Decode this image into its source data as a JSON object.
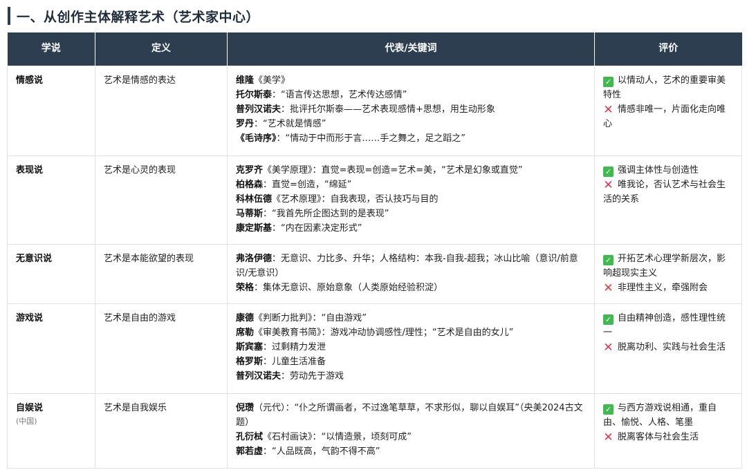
{
  "title": "一、从创作主体解释艺术（艺术家中心）",
  "columns": [
    "学说",
    "定义",
    "代表/关键词",
    "评价"
  ],
  "icons": {
    "positive": "check-icon",
    "negative": "cross-icon"
  },
  "colors": {
    "header_bg": "#2c3e50",
    "check": "#3fb950",
    "cross": "#e0344d"
  },
  "rows": [
    {
      "name": "情感说",
      "sub": "",
      "definition": "艺术是情感的表达",
      "reps": [
        {
          "who": "维隆",
          "text": "《美学》"
        },
        {
          "who": "托尔斯泰",
          "text": "：“语言传达思想，艺术传达感情”"
        },
        {
          "who": "普列汉诺夫",
          "text": "：批评托尔斯泰——艺术表现感情+思想，用生动形象"
        },
        {
          "who": "罗丹",
          "text": "：“艺术就是情感”"
        },
        {
          "who": "《毛诗序》",
          "text": "：“情动于中而形于言……手之舞之，足之蹈之”"
        }
      ],
      "pros": "以情动人，艺术的重要审美特性",
      "cons": "情感非唯一，片面化走向唯心"
    },
    {
      "name": "表现说",
      "sub": "",
      "definition": "艺术是心灵的表现",
      "reps": [
        {
          "who": "克罗齐",
          "text": "《美学原理》：直觉=表现=创造=艺术=美，“艺术是幻象或直觉”"
        },
        {
          "who": "柏格森",
          "text": "：直觉=创造，“绵延”"
        },
        {
          "who": "科林伍德",
          "text": "《艺术原理》：自我表现，否认技巧与目的"
        },
        {
          "who": "马蒂斯",
          "text": "：“我首先所企图达到的是表现”"
        },
        {
          "who": "康定斯基",
          "text": "：“内在因素决定形式”"
        }
      ],
      "pros": "强调主体性与创造性",
      "cons": "唯我论，否认艺术与社会生活的关系"
    },
    {
      "name": "无意识说",
      "sub": "",
      "definition": "艺术是本能欲望的表现",
      "reps": [
        {
          "who": "弗洛伊德",
          "text": "：无意识、力比多、升华；人格结构：本我-自我-超我；冰山比喻（意识/前意识/无意识）"
        },
        {
          "who": "荣格",
          "text": "：集体无意识、原始意象（人类原始经验积淀）"
        }
      ],
      "pros": "开拓艺术心理学新层次，影响超现实主义",
      "cons": "非理性主义，牵强附会"
    },
    {
      "name": "游戏说",
      "sub": "",
      "definition": "艺术是自由的游戏",
      "reps": [
        {
          "who": "康德",
          "text": "《判断力批判》：“自由游戏”"
        },
        {
          "who": "席勒",
          "text": "《审美教育书简》：游戏冲动协调感性/理性；“艺术是自由的女儿”"
        },
        {
          "who": "斯宾塞",
          "text": "：过剩精力发泄"
        },
        {
          "who": "格罗斯",
          "text": "：儿童生活准备"
        },
        {
          "who": "普列汉诺夫",
          "text": "：劳动先于游戏"
        }
      ],
      "pros": "自由精神创造，感性理性统一",
      "cons": "脱离功利、实践与社会生活"
    },
    {
      "name": "自娱说",
      "sub": "(中国)",
      "definition": "艺术是自我娱乐",
      "reps": [
        {
          "who": "倪瓒",
          "text": "（元代）：“仆之所谓画者，不过逸笔草草，不求形似，聊以自娱耳”（央美2024古文题）"
        },
        {
          "who": "孔衍栻",
          "text": "《石村画诀》：“以情造景，顷刻可成”"
        },
        {
          "who": "郭若虚",
          "text": "：“人品既高，气韵不得不高”"
        }
      ],
      "pros": "与西方游戏说相通，重自由、愉悦、人格、笔墨",
      "cons": "脱离客体与社会生活"
    }
  ]
}
